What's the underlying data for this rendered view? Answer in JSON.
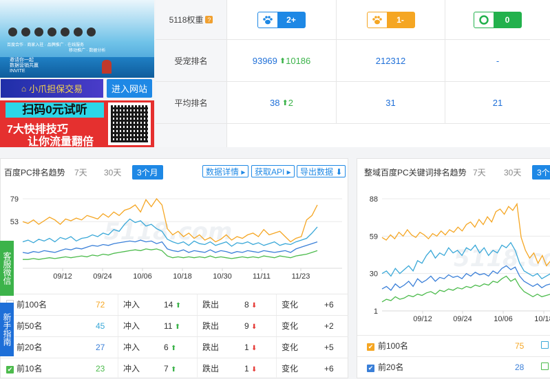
{
  "ads": {
    "top_caption": "百度合作 · 商家入驻 · 品牌推广 · 在线服务",
    "top_caption2": "移动推广 · 数据分析",
    "invite": "邀请你一起\n数据营销共赢\nINVITE",
    "xiaozhua": "小爪担保交易",
    "enter_site": "进入网站",
    "red_line1": "扫码0元试听",
    "red_line2": "7大快排技巧",
    "red_line3": "让你流量翻倍"
  },
  "weights": {
    "label_weight": "5118权重",
    "label_pet_rank": "受宠排名",
    "label_avg_rank": "平均排名",
    "badges": [
      {
        "value": "2+",
        "color": "#1e88e5",
        "icon": "paw-icon"
      },
      {
        "value": "1-",
        "color": "#f5a623",
        "icon": "paw-icon"
      },
      {
        "value": "0",
        "color": "#22b14c",
        "icon": "ring-icon"
      }
    ],
    "pet_rank": [
      {
        "value": "93969",
        "delta": "10186"
      },
      {
        "value": "212312",
        "delta": ""
      },
      {
        "value": "-",
        "delta": ""
      }
    ],
    "avg_rank": [
      {
        "value": "38",
        "delta": "2"
      },
      {
        "value": "31",
        "delta": ""
      },
      {
        "value": "21",
        "delta": ""
      }
    ]
  },
  "left_panel": {
    "title": "百度PC排名趋势",
    "tabs": [
      "7天",
      "30天",
      "3个月"
    ],
    "active_tab": 2,
    "buttons": [
      "数据详情 ▸",
      "获取API ▸",
      "导出数据 ⬇"
    ],
    "watermark": "5118.com",
    "y_ticks": [
      "79",
      "53"
    ],
    "x_ticks": [
      "09/12",
      "09/24",
      "10/06",
      "10/18",
      "10/30",
      "11/11",
      "11/23"
    ],
    "rows": [
      {
        "name": "前100名",
        "count": "72",
        "color": "#f5a623",
        "in_label": "冲入",
        "in": "14",
        "out_label": "跌出",
        "out": "8",
        "chg_label": "变化",
        "chg": "+6"
      },
      {
        "name": "前50名",
        "count": "45",
        "color": "#3aa8d8",
        "in_label": "冲入",
        "in": "11",
        "out_label": "跌出",
        "out": "9",
        "chg_label": "变化",
        "chg": "+2"
      },
      {
        "name": "前20名",
        "count": "27",
        "color": "#3a7fd8",
        "in_label": "冲入",
        "in": "6",
        "out_label": "跌出",
        "out": "1",
        "chg_label": "变化",
        "chg": "+5"
      },
      {
        "name": "前10名",
        "count": "23",
        "color": "#4cbb4c",
        "in_label": "冲入",
        "in": "7",
        "out_label": "跌出",
        "out": "1",
        "chg_label": "变化",
        "chg": "+6"
      }
    ]
  },
  "right_panel": {
    "title": "整域百度PC关键词排名趋势",
    "tabs": [
      "7天",
      "30天",
      "3个"
    ],
    "active_tab": 2,
    "watermark": "5118.com",
    "y_ticks": [
      "88",
      "59",
      "30",
      "1"
    ],
    "x_ticks": [
      "09/12",
      "09/24",
      "10/06",
      "10/18"
    ],
    "rows": [
      {
        "name": "前100名",
        "count": "75",
        "color": "#f5a623"
      },
      {
        "name": "前20名",
        "count": "28",
        "color": "#3a7fd8"
      }
    ]
  },
  "side_tags": [
    {
      "label": "客服微信",
      "color": "#3cb34a"
    },
    {
      "label": "新手指南",
      "color": "#1e6fd8"
    }
  ],
  "chart_data": [
    {
      "type": "line",
      "title": "",
      "xlabel": "",
      "ylabel": "",
      "ylim": [
        0,
        79
      ],
      "x_tick_labels": [
        "09/12",
        "09/24",
        "10/06",
        "10/18",
        "10/30",
        "11/11",
        "11/23"
      ],
      "series": [
        {
          "name": "前100名",
          "color": "#f5a623",
          "values": [
            53,
            51,
            55,
            50,
            54,
            58,
            55,
            50,
            56,
            54,
            57,
            55,
            60,
            58,
            56,
            62,
            58,
            64,
            60,
            66,
            68,
            72,
            64,
            78,
            70,
            79,
            72,
            45,
            38,
            42,
            36,
            40,
            34,
            38,
            32,
            35,
            30,
            33,
            38,
            32,
            36,
            34,
            38,
            40,
            36,
            44,
            38,
            40,
            42,
            36,
            30,
            34,
            36,
            55,
            60,
            72
          ]
        },
        {
          "name": "前50名",
          "color": "#3aa8d8",
          "values": [
            30,
            32,
            29,
            33,
            31,
            34,
            30,
            35,
            33,
            36,
            31,
            34,
            35,
            38,
            36,
            40,
            38,
            44,
            42,
            50,
            56,
            52,
            54,
            48,
            50,
            45,
            42,
            33,
            30,
            28,
            30,
            26,
            31,
            28,
            27,
            30,
            26,
            28,
            30,
            25,
            29,
            28,
            30,
            27,
            29,
            26,
            28,
            30,
            26,
            28,
            27,
            30,
            32,
            34,
            40,
            47
          ]
        },
        {
          "name": "前20名",
          "color": "#3a7fd8",
          "values": [
            18,
            17,
            19,
            18,
            20,
            19,
            18,
            20,
            22,
            21,
            23,
            22,
            24,
            26,
            25,
            27,
            26,
            28,
            29,
            30,
            31,
            30,
            32,
            30,
            31,
            28,
            30,
            22,
            20,
            19,
            21,
            18,
            20,
            19,
            18,
            21,
            18,
            20,
            19,
            17,
            19,
            18,
            20,
            19,
            18,
            20,
            19,
            18,
            19,
            20,
            18,
            22,
            24,
            26,
            28,
            30
          ]
        },
        {
          "name": "前10名",
          "color": "#4cbb4c",
          "values": [
            10,
            10,
            11,
            10,
            11,
            12,
            11,
            12,
            13,
            12,
            13,
            14,
            13,
            15,
            14,
            16,
            15,
            17,
            18,
            19,
            20,
            21,
            20,
            22,
            21,
            22,
            20,
            14,
            12,
            13,
            12,
            13,
            12,
            13,
            12,
            14,
            12,
            13,
            12,
            11,
            12,
            13,
            12,
            13,
            12,
            14,
            13,
            12,
            14,
            13,
            12,
            14,
            15,
            16,
            18,
            20
          ]
        }
      ]
    },
    {
      "type": "line",
      "title": "",
      "xlabel": "",
      "ylabel": "",
      "ylim": [
        1,
        88
      ],
      "x_tick_labels": [
        "09/12",
        "09/24",
        "10/06",
        "10/18"
      ],
      "series": [
        {
          "name": "前100名",
          "color": "#f5a623",
          "values": [
            58,
            56,
            60,
            57,
            62,
            59,
            64,
            60,
            58,
            62,
            60,
            57,
            61,
            59,
            63,
            60,
            64,
            62,
            66,
            63,
            68,
            70,
            66,
            72,
            68,
            74,
            70,
            78,
            80,
            76,
            82,
            79,
            84,
            58,
            48,
            42,
            46,
            38,
            44,
            36,
            40
          ]
        },
        {
          "name": "前50名",
          "color": "#3aa8d8",
          "values": [
            30,
            32,
            28,
            34,
            30,
            33,
            36,
            32,
            40,
            38,
            44,
            48,
            42,
            46,
            44,
            50,
            46,
            48,
            44,
            50,
            48,
            52,
            46,
            50,
            44,
            48,
            46,
            52,
            50,
            54,
            48,
            38,
            32,
            30,
            28,
            30,
            26,
            28,
            30
          ]
        },
        {
          "name": "前20名",
          "color": "#3a7fd8",
          "values": [
            18,
            20,
            17,
            22,
            19,
            21,
            24,
            20,
            26,
            23,
            25,
            28,
            24,
            27,
            26,
            29,
            27,
            28,
            26,
            30,
            28,
            31,
            29,
            30,
            28,
            32,
            30,
            34,
            36,
            33,
            35,
            28,
            24,
            22,
            20,
            22,
            19,
            21,
            22
          ]
        },
        {
          "name": "前10名",
          "color": "#4cbb4c",
          "values": [
            8,
            10,
            9,
            12,
            10,
            11,
            13,
            12,
            14,
            13,
            15,
            16,
            14,
            17,
            16,
            18,
            17,
            19,
            18,
            20,
            19,
            21,
            20,
            22,
            21,
            24,
            23,
            26,
            28,
            24,
            26,
            20,
            16,
            14,
            12,
            14,
            12,
            13,
            14
          ]
        }
      ]
    }
  ]
}
